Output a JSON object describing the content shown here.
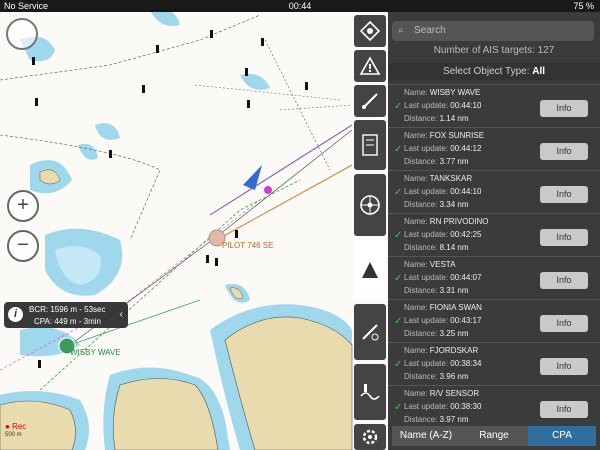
{
  "status_bar": {
    "carrier": "No Service",
    "time": "00:44",
    "battery": "75 %"
  },
  "map": {
    "zoom_in_label": "+",
    "zoom_out_label": "−",
    "vessel_labels": [
      "PILOT 746 SE",
      "WISBY WAVE"
    ],
    "rec_label": "Rec",
    "scale_label": "500 m",
    "cpa_info": {
      "bcr": "BCR: 1596 m - 53sec",
      "cpa": "CPA: 449 m - 3min",
      "icon": "info-icon"
    }
  },
  "toolbar_icons": [
    "ais-target-icon",
    "warning-icon",
    "route-edit-icon",
    "chart-layers-icon",
    "steering-wheel-icon",
    "ais-list-icon",
    "weather-tools-icon",
    "tides-icon",
    "settings-icon"
  ],
  "panel": {
    "search_placeholder": "Search",
    "target_count": "Number of AIS targets: 127",
    "select_type_label": "Select Object Type:",
    "select_type_value": "All",
    "name_prefix": "Name:",
    "update_prefix": "Last update:",
    "distance_prefix": "Distance:",
    "info_label": "Info",
    "targets": [
      {
        "name": "WISBY WAVE",
        "last_update": "00:44:10",
        "distance": "1.14 nm"
      },
      {
        "name": "FOX SUNRISE",
        "last_update": "00:44:12",
        "distance": "3.77 nm"
      },
      {
        "name": "TANKSKAR",
        "last_update": "00:44:10",
        "distance": "3.34 nm"
      },
      {
        "name": "RN PRIVODINO",
        "last_update": "00:42:25",
        "distance": "8.14 nm"
      },
      {
        "name": "VESTA",
        "last_update": "00:44:07",
        "distance": "3.31 nm"
      },
      {
        "name": "FIONIA SWAN",
        "last_update": "00:43:17",
        "distance": "3.25 nm"
      },
      {
        "name": "FJORDSKAR",
        "last_update": "00:38:34",
        "distance": "3.96 nm"
      },
      {
        "name": "R/V SENSOR",
        "last_update": "00:38:30",
        "distance": "3.97 nm"
      }
    ],
    "sort_tabs": [
      {
        "label": "Name (A-Z)",
        "selected": false
      },
      {
        "label": "Range",
        "selected": false
      },
      {
        "label": "CPA",
        "selected": true
      }
    ]
  },
  "colors": {
    "land": "#e8dcae",
    "shallow": "#9fd8ec",
    "deep_water": "#ffffff",
    "panel_bg": "#3b3b3b",
    "selected_tab": "#2e6f9e",
    "check": "#33cc33"
  }
}
